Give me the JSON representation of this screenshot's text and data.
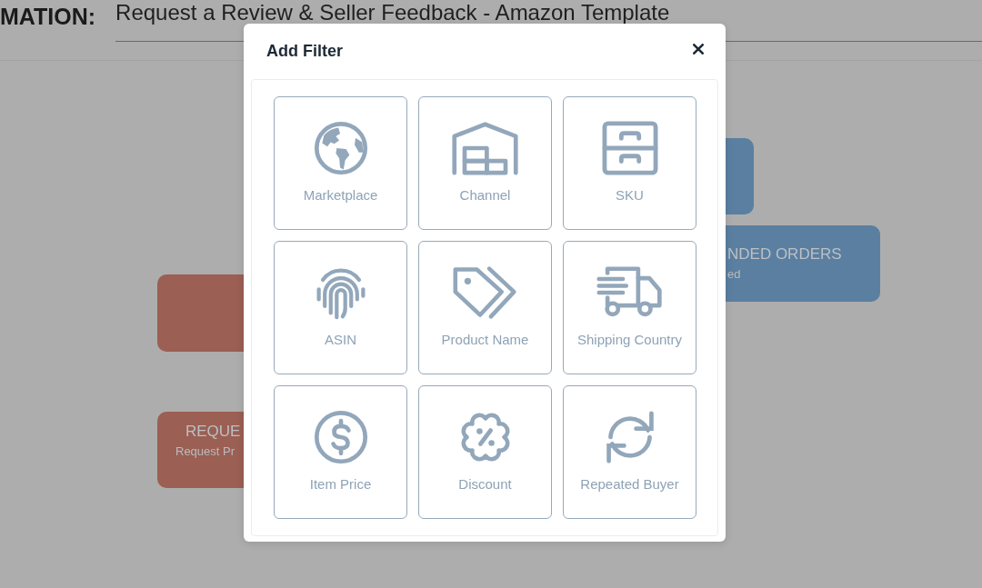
{
  "header": {
    "section_label": "MATION:",
    "title": "Request a Review & Seller Feedback - Amazon Template"
  },
  "flow_nodes": [
    {
      "color": "#5a7fa0"
    },
    {
      "color": "#5a7fa0",
      "title": "NDED ORDERS",
      "subtitle": "ed"
    },
    {
      "color": "#9b5f53"
    },
    {
      "color": "#9b5f53",
      "title": "REQUE",
      "subtitle": "Request Pr"
    }
  ],
  "dialog": {
    "title": "Add Filter",
    "filters": [
      {
        "kind": "globe",
        "label": "Marketplace"
      },
      {
        "kind": "warehouse",
        "label": "Channel"
      },
      {
        "kind": "drawers",
        "label": "SKU"
      },
      {
        "kind": "fingerprint",
        "label": "ASIN"
      },
      {
        "kind": "tags",
        "label": "Product Name"
      },
      {
        "kind": "truck",
        "label": "Shipping Country"
      },
      {
        "kind": "dollar",
        "label": "Item Price"
      },
      {
        "kind": "discount",
        "label": "Discount"
      },
      {
        "kind": "refresh",
        "label": "Repeated Buyer"
      }
    ]
  }
}
